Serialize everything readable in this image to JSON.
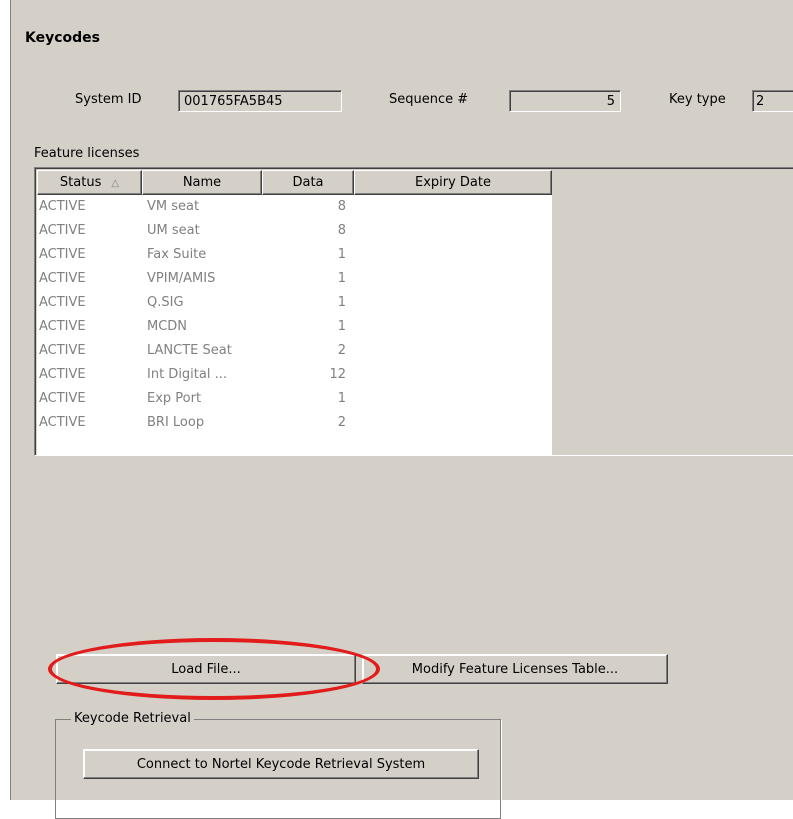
{
  "title": "Keycodes",
  "system_id": {
    "label": "System ID",
    "value": "001765FA5B45"
  },
  "sequence": {
    "label": "Sequence #",
    "value": "5"
  },
  "key_type": {
    "label": "Key type",
    "value": "2"
  },
  "feature_licenses": {
    "label": "Feature licenses",
    "columns": [
      "Status",
      "Name",
      "Data",
      "Expiry Date"
    ],
    "sort_icon": "sort-up-triangle-icon",
    "rows": [
      {
        "status": "ACTIVE",
        "name": "VM seat",
        "data": "8",
        "expiry": ""
      },
      {
        "status": "ACTIVE",
        "name": "UM seat",
        "data": "8",
        "expiry": ""
      },
      {
        "status": "ACTIVE",
        "name": "Fax Suite",
        "data": "1",
        "expiry": ""
      },
      {
        "status": "ACTIVE",
        "name": "VPIM/AMIS",
        "data": "1",
        "expiry": ""
      },
      {
        "status": "ACTIVE",
        "name": "Q.SIG",
        "data": "1",
        "expiry": ""
      },
      {
        "status": "ACTIVE",
        "name": "MCDN",
        "data": "1",
        "expiry": ""
      },
      {
        "status": "ACTIVE",
        "name": "LANCTE Seat",
        "data": "2",
        "expiry": ""
      },
      {
        "status": "ACTIVE",
        "name": "Int Digital ...",
        "data": "12",
        "expiry": ""
      },
      {
        "status": "ACTIVE",
        "name": "Exp Port",
        "data": "1",
        "expiry": ""
      },
      {
        "status": "ACTIVE",
        "name": "BRI Loop",
        "data": "2",
        "expiry": ""
      }
    ]
  },
  "buttons": {
    "load_file": "Load File...",
    "modify_table": "Modify Feature Licenses Table..."
  },
  "keycode_retrieval": {
    "label": "Keycode Retrieval",
    "connect_button": "Connect to Nortel Keycode Retrieval System"
  },
  "highlight_color": "#e21b1b"
}
